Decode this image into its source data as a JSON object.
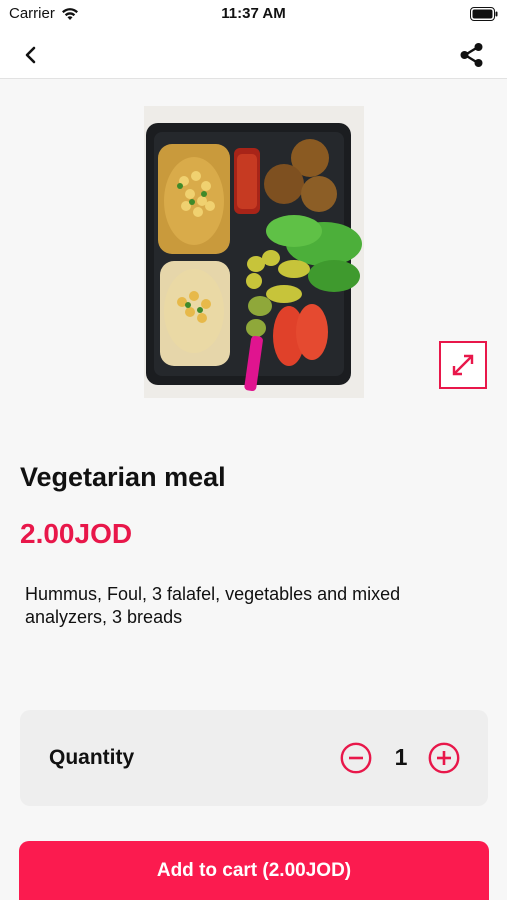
{
  "status_bar": {
    "carrier": "Carrier",
    "time": "11:37 AM",
    "wifi_icon": "wifi-icon",
    "battery_icon": "battery-icon"
  },
  "nav": {
    "back_icon": "chevron-left-icon",
    "share_icon": "share-icon"
  },
  "product": {
    "title": "Vegetarian meal",
    "price": "2.00JOD",
    "description": "Hummus, Foul, 3 falafel, vegetables and mixed analyzers, 3 breads",
    "image_icon": "meal-photo",
    "expand_icon": "expand-icon"
  },
  "quantity": {
    "label": "Quantity",
    "value": "1",
    "minus_icon": "minus-circle-icon",
    "plus_icon": "plus-circle-icon"
  },
  "cart": {
    "button_label": "Add to cart (2.00JOD)"
  },
  "colors": {
    "accent": "#e8174a",
    "button": "#fb1b4f",
    "background": "#f7f7f7",
    "card": "#eeeeee"
  }
}
